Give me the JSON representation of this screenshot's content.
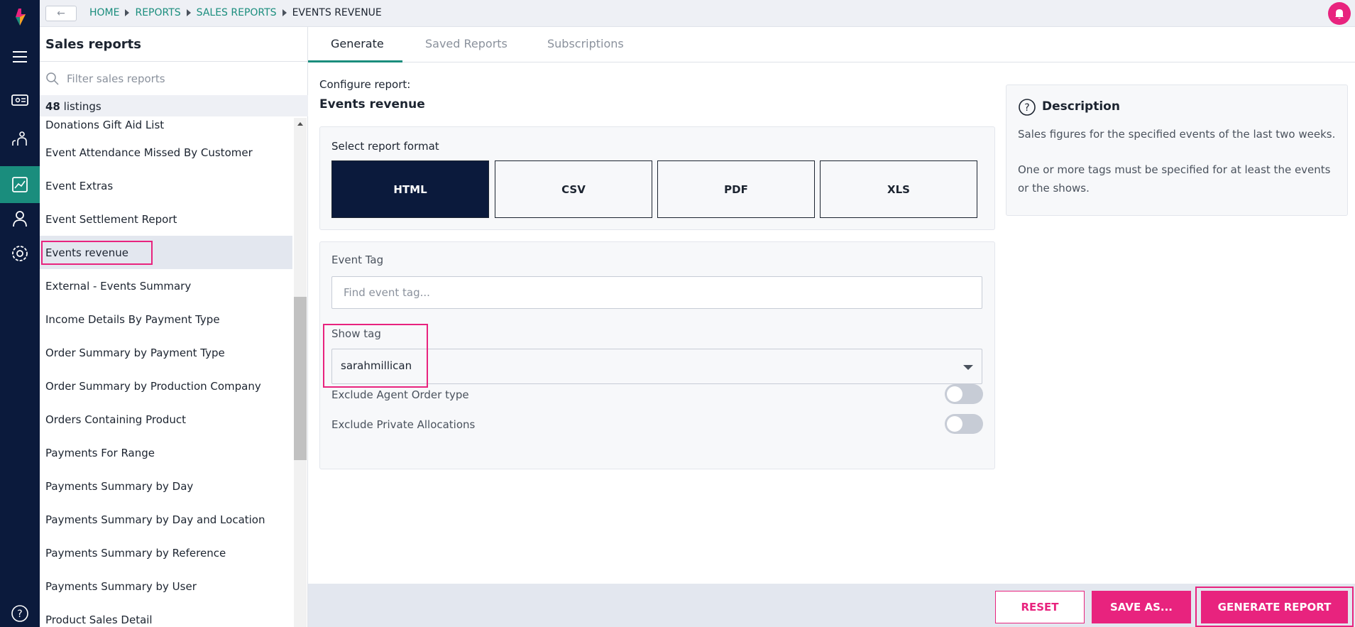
{
  "breadcrumb": {
    "items": [
      "HOME",
      "REPORTS",
      "SALES REPORTS"
    ],
    "current": "EVENTS REVENUE"
  },
  "sidebar": {
    "title": "Sales reports",
    "filter_placeholder": "Filter sales reports",
    "count": "48",
    "count_suffix": "listings",
    "items": [
      "Donations Gift Aid List",
      "Event Attendance Missed By Customer",
      "Event Extras",
      "Event Settlement Report",
      "Events revenue",
      "External - Events Summary",
      "Income Details By Payment Type",
      "Order Summary by Payment Type",
      "Order Summary by Production Company",
      "Orders Containing Product",
      "Payments For Range",
      "Payments Summary by Day",
      "Payments Summary by Day and Location",
      "Payments Summary by Reference",
      "Payments Summary by User",
      "Product Sales Detail"
    ],
    "selected_index": 4
  },
  "tabs": [
    "Generate",
    "Saved Reports",
    "Subscriptions"
  ],
  "active_tab": "Generate",
  "config": {
    "label": "Configure report:",
    "title": "Events revenue"
  },
  "format": {
    "label": "Select report format",
    "options": [
      "HTML",
      "CSV",
      "PDF",
      "XLS"
    ],
    "selected": "HTML"
  },
  "params": {
    "event_tag_label": "Event Tag",
    "event_tag_placeholder": "Find event tag...",
    "show_tag_label": "Show tag",
    "show_tag_value": "sarahmillican",
    "exclude_agent_label": "Exclude Agent Order type",
    "exclude_agent_on": false,
    "exclude_private_label": "Exclude Private Allocations",
    "exclude_private_on": false
  },
  "description": {
    "title": "Description",
    "line1": "Sales figures for the specified events of the last two weeks.",
    "line2": "One or more tags must be specified for at least the events or the shows."
  },
  "actions": {
    "reset": "RESET",
    "save_as": "SAVE AS...",
    "generate": "GENERATE REPORT"
  },
  "colors": {
    "rail": "#0b1a3c",
    "accent": "#1a8d7d",
    "brand_pink": "#e8237e"
  }
}
